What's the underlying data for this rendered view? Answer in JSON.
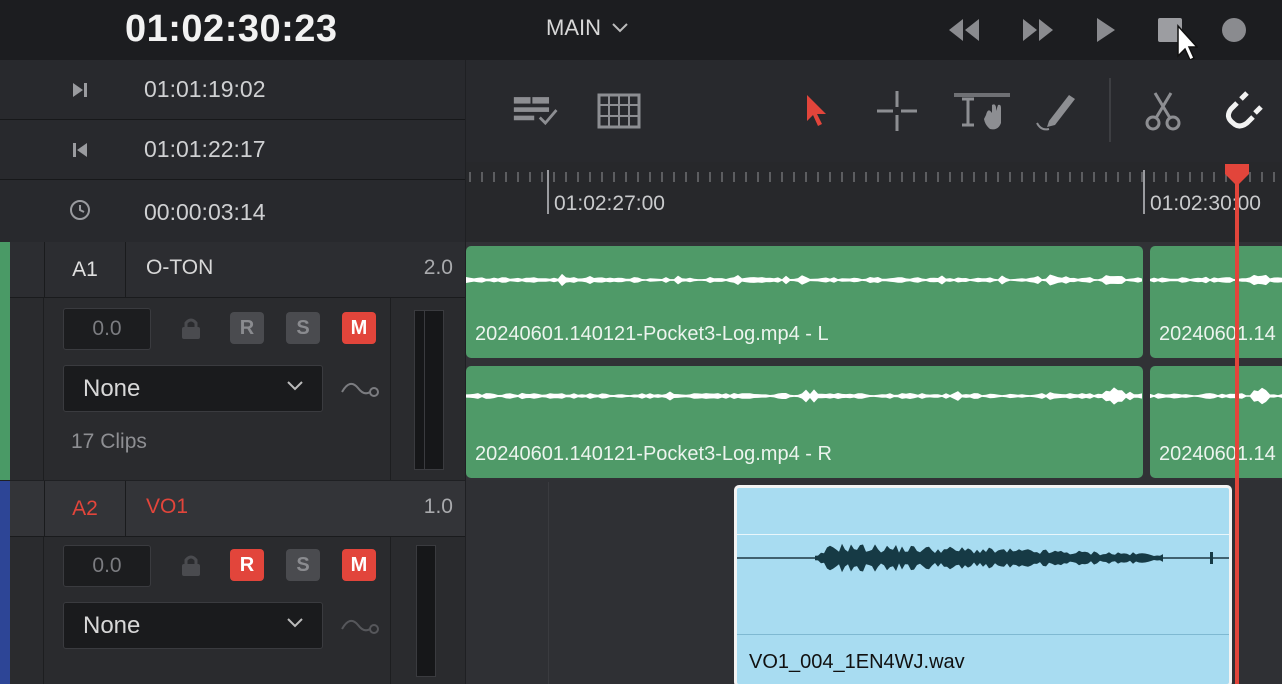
{
  "header": {
    "timecode": "01:02:30:23",
    "timeline_name": "MAIN"
  },
  "info_rows": [
    {
      "icon": "mark-in-icon",
      "value": "01:01:19:02"
    },
    {
      "icon": "mark-out-icon",
      "value": "01:01:22:17"
    },
    {
      "icon": "duration-clock-icon",
      "value": "00:00:03:14"
    }
  ],
  "ruler": {
    "labels": [
      "01:02:27:00",
      "01:02:30:00"
    ]
  },
  "tracks": [
    {
      "id": "A1",
      "name": "O-TON",
      "level": "2.0",
      "volume": "0.0",
      "record": "R",
      "solo": "S",
      "mute": "M",
      "effect": "None",
      "clip_count": "17 Clips",
      "color": "#4a9a66"
    },
    {
      "id": "A2",
      "name": "VO1",
      "level": "1.0",
      "volume": "0.0",
      "record": "R",
      "solo": "S",
      "mute": "M",
      "effect": "None",
      "color": "#2d4596"
    }
  ],
  "clips": {
    "a1_left_l": "20240601.140121-Pocket3-Log.mp4 - L",
    "a1_left_r": "20240601.140121-Pocket3-Log.mp4 - R",
    "a1_right_l": "20240601.14",
    "a1_right_r": "20240601.14",
    "vo": "VO1_004_1EN4WJ.wav"
  },
  "colors": {
    "accent_red": "#e2453b",
    "clip_green": "#4f9a68",
    "clip_blue": "#a8dcf1"
  }
}
